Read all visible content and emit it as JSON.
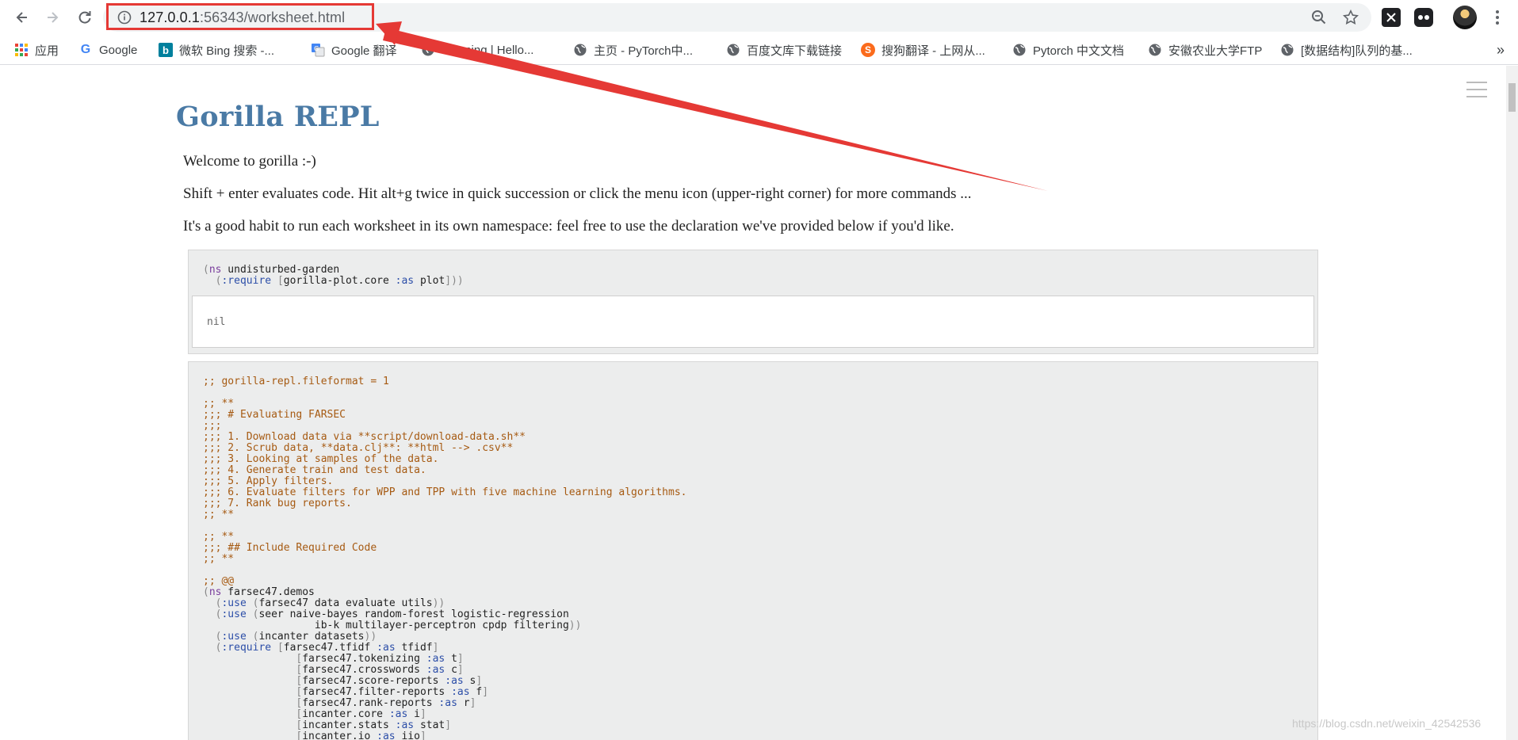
{
  "browser": {
    "url": "127.0.0.1:56343/worksheet.html",
    "url_host": "127.0.0.1",
    "url_rest": ":56343/worksheet.html",
    "toolbar_icons": [
      "back-icon",
      "forward-icon",
      "reload-icon",
      "info-icon",
      "zoom-icon",
      "star-icon",
      "extension-x-icon",
      "extension-dots-icon",
      "avatar",
      "kebab-menu-icon"
    ]
  },
  "bookmarks": {
    "items": [
      {
        "label": "应用",
        "icon": "apps-grid-icon"
      },
      {
        "label": "Google",
        "icon": "google-icon"
      },
      {
        "label": "微软 Bing 搜索 -...",
        "icon": "bing-icon"
      },
      {
        "label": "Google 翻译",
        "icon": "translate-icon"
      },
      {
        "label": "Manning | Hello...",
        "icon": "globe-icon"
      },
      {
        "label": "主页 - PyTorch中...",
        "icon": "globe-icon"
      },
      {
        "label": "百度文库下载链接",
        "icon": "globe-icon"
      },
      {
        "label": "搜狗翻译 - 上网从...",
        "icon": "sogou-icon"
      },
      {
        "label": "Pytorch 中文文档",
        "icon": "globe-icon"
      },
      {
        "label": "安徽农业大学FTP",
        "icon": "globe-icon"
      },
      {
        "label": "[数据结构]队列的基...",
        "icon": "globe-icon"
      }
    ],
    "overflow": "»"
  },
  "page": {
    "title": "Gorilla REPL",
    "welcome": "Welcome to gorilla :-)",
    "help": "Shift + enter evaluates code. Hit alt+g twice in quick succession or click the menu icon (upper-right corner) for more commands ...",
    "namespace_tip": "It's a good habit to run each worksheet in its own namespace: feel free to use the declaration we've provided below if you'd like."
  },
  "cells": [
    {
      "code_lines": [
        "(ns undisturbed-garden",
        "  (:require [gorilla-plot.core :as plot]))"
      ],
      "output": "nil"
    },
    {
      "code_lines": [
        ";; gorilla-repl.fileformat = 1",
        "",
        ";; **",
        ";;; # Evaluating FARSEC",
        ";;; ",
        ";;; 1. Download data via **script/download-data.sh**",
        ";;; 2. Scrub data, **data.clj**: **html --> .csv**",
        ";;; 3. Looking at samples of the data.",
        ";;; 4. Generate train and test data.",
        ";;; 5. Apply filters.",
        ";;; 6. Evaluate filters for WPP and TPP with five machine learning algorithms.",
        ";;; 7. Rank bug reports.",
        ";; **",
        "",
        ";; **",
        ";;; ## Include Required Code",
        ";; **",
        "",
        ";; @@",
        "(ns farsec47.demos",
        "  (:use (farsec47 data evaluate utils))",
        "  (:use (seer naive-bayes random-forest logistic-regression",
        "                  ib-k multilayer-perceptron cpdp filtering))",
        "  (:use (incanter datasets))",
        "  (:require [farsec47.tfidf :as tfidf]",
        "               [farsec47.tokenizing :as t]",
        "               [farsec47.crosswords :as c]",
        "               [farsec47.score-reports :as s]",
        "               [farsec47.filter-reports :as f]",
        "               [farsec47.rank-reports :as r]",
        "               [incanter.core :as i]",
        "               [incanter.stats :as stat]",
        "               [incanter.io :as iio]"
      ]
    }
  ],
  "watermark": "https://blog.csdn.net/weixin_42542536",
  "colors": {
    "title": "#4a7aa5",
    "annotation": "#e53935",
    "comment": "#a65a12",
    "keyword": "#7a3e9d",
    "keyword_arg": "#2c4ea8"
  }
}
